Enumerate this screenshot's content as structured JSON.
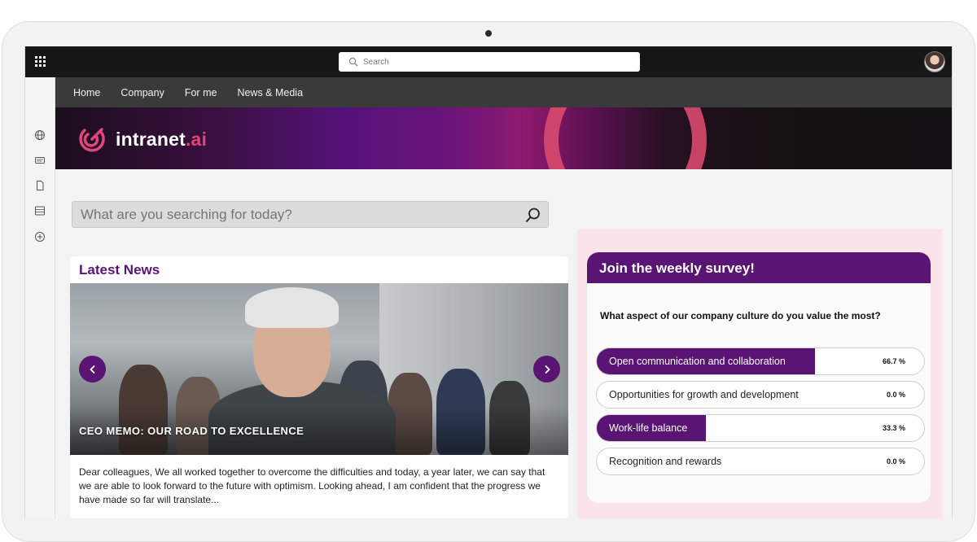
{
  "topbar": {
    "search_placeholder": "Search"
  },
  "nav": {
    "items": [
      "Home",
      "Company",
      "For me",
      "News & Media"
    ]
  },
  "brand": {
    "name": "intranet",
    "suffix": ".ai",
    "accent": "#e0467a",
    "primary": "#5a1474"
  },
  "hero_search": {
    "placeholder": "What are you searching for today?"
  },
  "news": {
    "section_title": "Latest News",
    "headline": "CEO MEMO: OUR ROAD TO EXCELLENCE",
    "excerpt": "Dear colleagues, We all worked together to overcome the difficulties and today, a year later, we can say that we are able to look forward to the future with optimism. Looking ahead, I am confident that the progress we have made so far will translate..."
  },
  "survey": {
    "title": "Join the weekly survey!",
    "question": "What aspect of our company culture do you value the most?",
    "options": [
      {
        "label": "Open communication and collaboration",
        "percent_text": "66.7 %",
        "percent": 66.7
      },
      {
        "label": "Opportunities for growth and development",
        "percent_text": "0.0 %",
        "percent": 0
      },
      {
        "label": "Work-life balance",
        "percent_text": "33.3 %",
        "percent": 33.3
      },
      {
        "label": "Recognition and rewards",
        "percent_text": "0.0 %",
        "percent": 0
      }
    ]
  },
  "icons": {
    "rail": [
      "globe-icon",
      "card-icon",
      "document-icon",
      "list-icon",
      "add-circle-icon"
    ],
    "top": [
      "app-launcher-icon",
      "search-icon",
      "avatar"
    ]
  }
}
